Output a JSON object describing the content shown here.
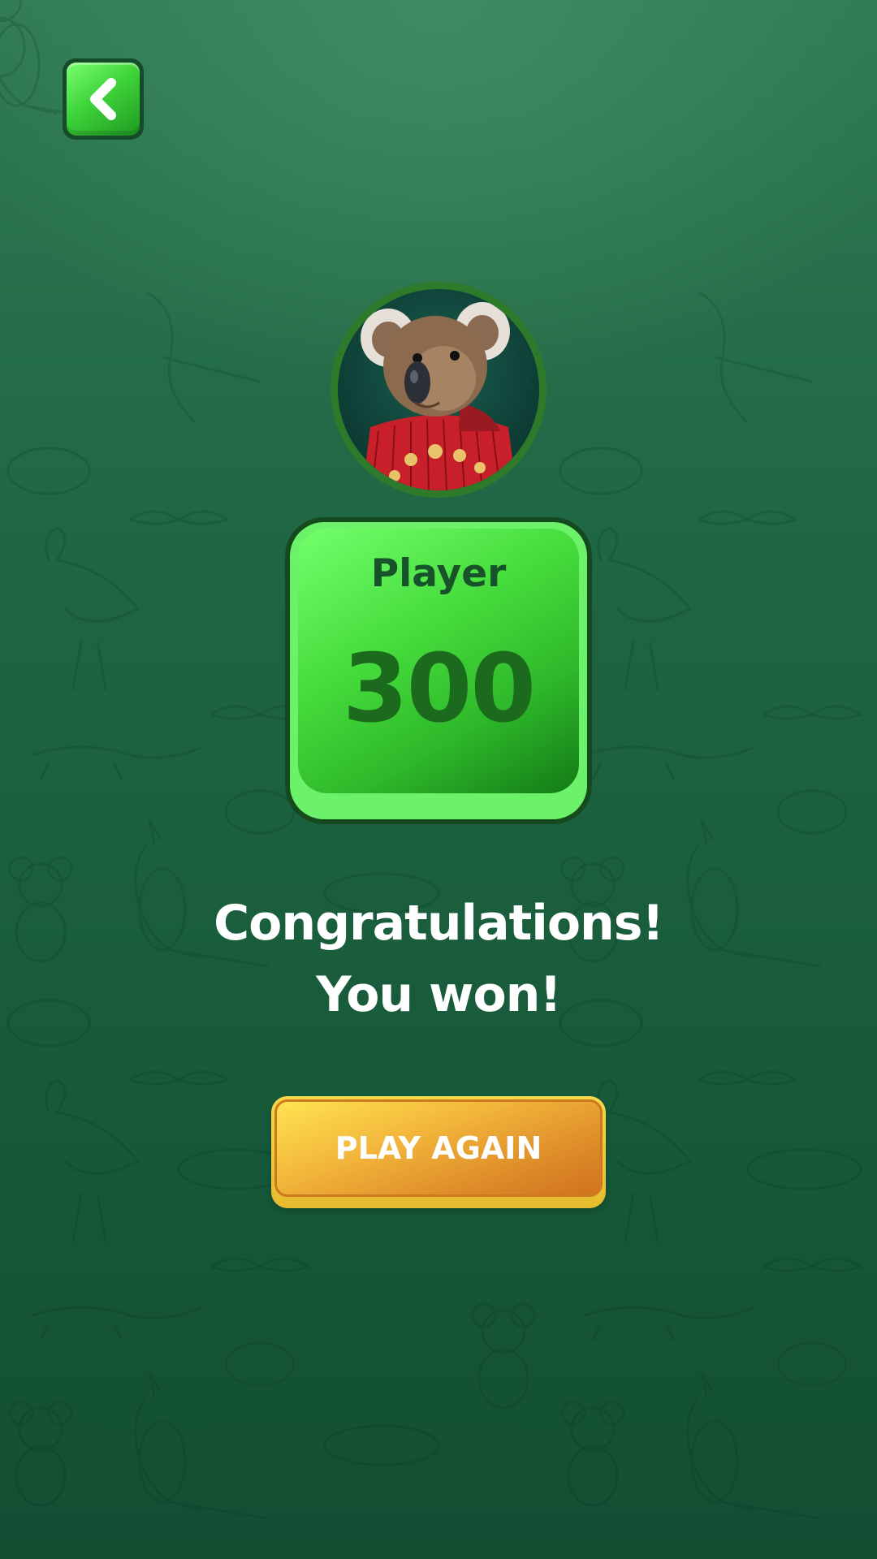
{
  "player": {
    "label": "Player",
    "score": "300"
  },
  "message": {
    "line1": "Congratulations!",
    "line2": "You won!"
  },
  "buttons": {
    "play_again_label": "PLAY AGAIN"
  },
  "icons": {
    "back": "chevron-left-icon",
    "avatar": "koala-avatar"
  },
  "colors": {
    "background": "#1f6644",
    "accent_green": "#46dc3c",
    "button_orange": "#f2b53a",
    "text_white": "#ffffff"
  }
}
